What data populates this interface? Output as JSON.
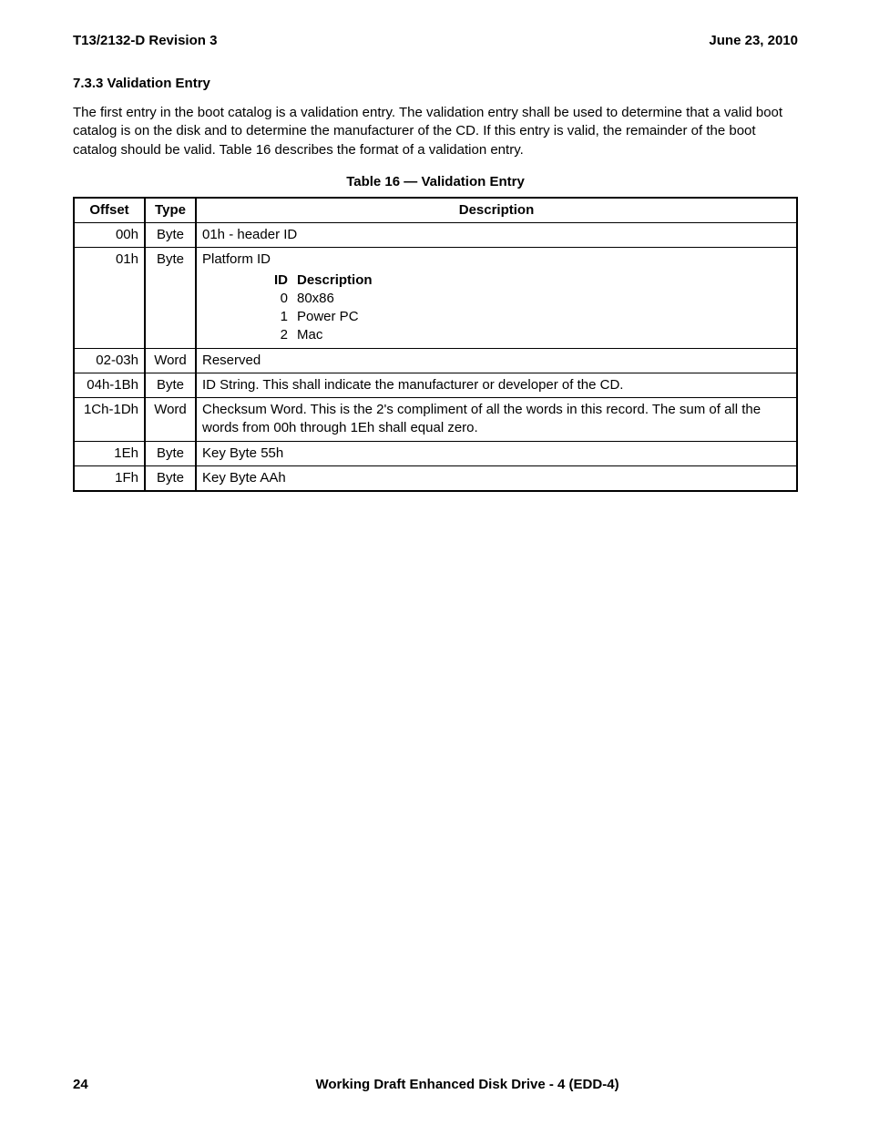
{
  "header": {
    "doc_id": "T13/2132-D Revision 3",
    "date": "June 23, 2010"
  },
  "section": {
    "number_title": "7.3.3 Validation Entry",
    "paragraph": "The first entry in the boot catalog is a validation entry.  The validation entry shall be used to determine that a valid boot catalog is on the disk and to determine the manufacturer of the CD.  If this entry is valid, the remainder of the boot catalog should be valid.  Table 16 describes the format of a validation entry."
  },
  "table": {
    "caption": "Table 16 — Validation Entry",
    "columns": {
      "offset": "Offset",
      "type": "Type",
      "description": "Description"
    },
    "sub_columns": {
      "id": "ID",
      "description": "Description"
    },
    "rows": [
      {
        "offset": "00h",
        "type": "Byte",
        "description": "01h - header ID"
      },
      {
        "offset": "01h",
        "type": "Byte",
        "description": "Platform ID",
        "sub": [
          {
            "id": "0",
            "desc": "80x86"
          },
          {
            "id": "1",
            "desc": "Power PC"
          },
          {
            "id": "2",
            "desc": "Mac"
          }
        ]
      },
      {
        "offset": "02-03h",
        "type": "Word",
        "description": "Reserved"
      },
      {
        "offset": "04h-1Bh",
        "type": "Byte",
        "description": "ID String.  This shall indicate the manufacturer or developer of the CD."
      },
      {
        "offset": "1Ch-1Dh",
        "type": "Word",
        "description": "Checksum Word.  This is the 2's compliment of all the words in this record.  The sum of all the words from 00h through 1Eh shall equal zero."
      },
      {
        "offset": "1Eh",
        "type": "Byte",
        "description": "Key Byte 55h"
      },
      {
        "offset": "1Fh",
        "type": "Byte",
        "description": "Key Byte AAh"
      }
    ]
  },
  "footer": {
    "page": "24",
    "title": "Working Draft Enhanced Disk Drive - 4  (EDD-4)"
  }
}
